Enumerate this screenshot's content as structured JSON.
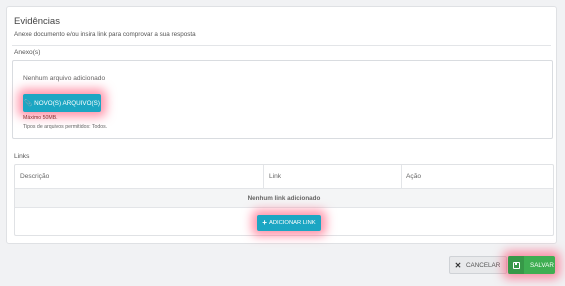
{
  "section": {
    "title": "Evidências",
    "subtitle": "Anexe documento e/ou insira link para comprovar a sua resposta"
  },
  "attachments": {
    "label": "Anexo(s)",
    "empty_text": "Nenhum arquivo adicionado",
    "new_button_label": "NOVO(S) ARQUIVO(S)",
    "max_size_text": "Máximo 50MB.",
    "allowed_types_text": "Tipos de arquivos permitidos: Todos."
  },
  "links": {
    "label": "Links",
    "columns": [
      "Descrição",
      "Link",
      "Ação"
    ],
    "empty_text": "Nenhum link adicionado",
    "add_button_label": "ADICIONAR LINK"
  },
  "footer": {
    "cancel_label": "CANCELAR",
    "save_label": "SALVAR"
  },
  "colors": {
    "primary": "#1ba6c3",
    "success": "#3fae52",
    "highlight": "#ff3c64"
  },
  "icons": {
    "new_file": "paperclip-icon",
    "add_link": "plus-icon",
    "cancel": "close-icon",
    "save": "floppy-disk-icon"
  }
}
